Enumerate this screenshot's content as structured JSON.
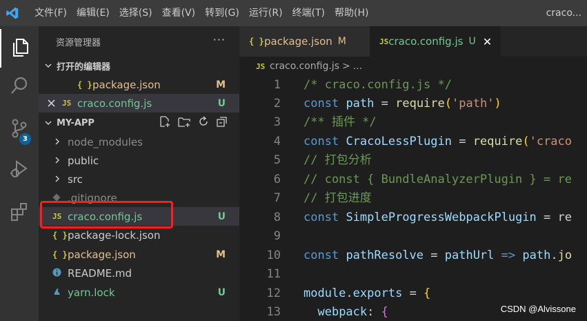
{
  "app": {
    "window_title": "craco..."
  },
  "menu": [
    "文件(F)",
    "编辑(E)",
    "选择(S)",
    "查看(V)",
    "转到(G)",
    "运行(R)",
    "终端(T)",
    "帮助(H)"
  ],
  "activity": {
    "scm_badge": "3",
    "icons": [
      "files-icon",
      "search-icon",
      "source-control-icon",
      "run-debug-icon",
      "extensions-icon"
    ]
  },
  "sidebar": {
    "title": "资源管理器",
    "more": "···",
    "open_editors": {
      "label": "打开的编辑器",
      "items": [
        {
          "name": "package.json",
          "status": "M",
          "icon": "{ }"
        },
        {
          "name": "craco.config.js",
          "status": "U",
          "icon": "JS"
        }
      ]
    },
    "project": {
      "label": "MY-APP",
      "items": [
        {
          "name": "node_modules",
          "status": ""
        },
        {
          "name": "public",
          "status": ""
        },
        {
          "name": "src",
          "status": ""
        },
        {
          "name": ".gitignore",
          "status": ""
        },
        {
          "name": "craco.config.js",
          "status": "U",
          "icon": "JS"
        },
        {
          "name": "package-lock.json",
          "status": "",
          "icon": "{ }"
        },
        {
          "name": "package.json",
          "status": "M",
          "icon": "{ }"
        },
        {
          "name": "README.md",
          "status": ""
        },
        {
          "name": "yarn.lock",
          "status": "U"
        }
      ]
    }
  },
  "editor": {
    "tabs": [
      {
        "icon": "{ }",
        "name": "package.json",
        "mark": "M"
      },
      {
        "icon": "JS",
        "name": "craco.config.js",
        "mark": "U",
        "close": "✕"
      }
    ],
    "breadcrumb": {
      "icon": "JS",
      "file": "craco.config.js",
      "sep": ">",
      "rest": "..."
    },
    "line_numbers": [
      "1",
      "2",
      "3",
      "4",
      "5",
      "6",
      "7",
      "8",
      "9",
      "10",
      "11",
      "12",
      "13"
    ]
  },
  "watermark": "CSDN @Alvissone",
  "colors": {
    "modified": "#e2c08d",
    "untracked": "#73c991",
    "highlight_box": "#ff1e1e",
    "accent": "#0e639c"
  }
}
